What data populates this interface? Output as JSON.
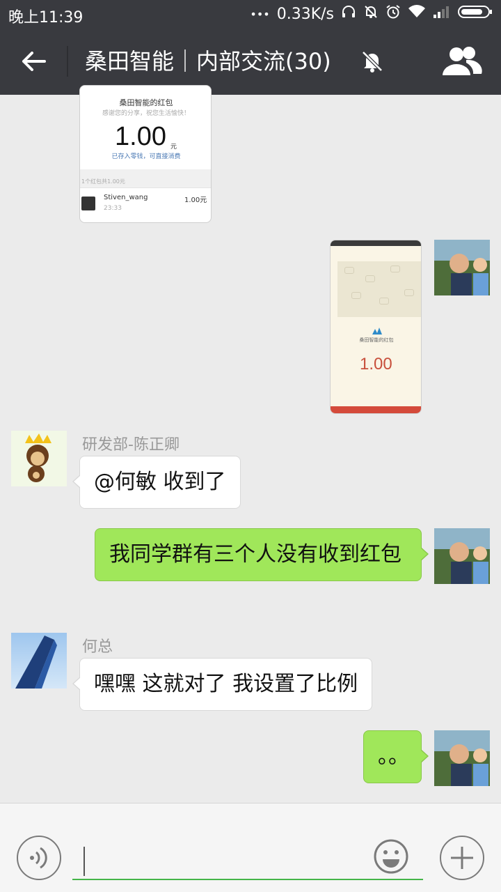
{
  "status_bar": {
    "time": "晚上11:39",
    "dots": "•••",
    "speed": "0.33K/s",
    "icons": [
      "headphones-icon",
      "alarm-off-icon",
      "alarm-icon",
      "wifi-icon",
      "signal-icon",
      "battery-icon"
    ]
  },
  "header": {
    "title": "桑田智能｜内部交流(30)",
    "back_icon": "arrow-left-icon",
    "mute_icon": "bell-off-icon",
    "members_icon": "group-icon"
  },
  "messages": {
    "img1": {
      "title": "桑田智能的红包",
      "subtitle": "感谢您的分享，祝您生活愉快！",
      "amount": "1.00",
      "unit": "元",
      "note": "已存入零钱，可直接消费",
      "summary": "1个红包共1.00元",
      "row_name": "Stiven_wang",
      "row_time": "23:33",
      "row_amount": "1.00元"
    },
    "img2": {
      "title": "桑田智能的红包",
      "amount": "1.00"
    },
    "m3": {
      "sender": "研发部-陈正卿",
      "text": "@何敏 收到了"
    },
    "m4": {
      "text": "我同学群有三个人没有收到红包"
    },
    "m5": {
      "sender": "何总",
      "text": "嘿嘿 这就对了 我设置了比例"
    },
    "m6": {
      "text": "。。"
    }
  },
  "input_bar": {
    "value": "",
    "voice_icon": "voice-icon",
    "emoji_icon": "emoji-icon",
    "plus_icon": "plus-icon"
  },
  "colors": {
    "header_bg": "#393a3f",
    "chat_bg": "#ebebeb",
    "self_bubble": "#a0e75a",
    "input_underline": "#44b549"
  }
}
